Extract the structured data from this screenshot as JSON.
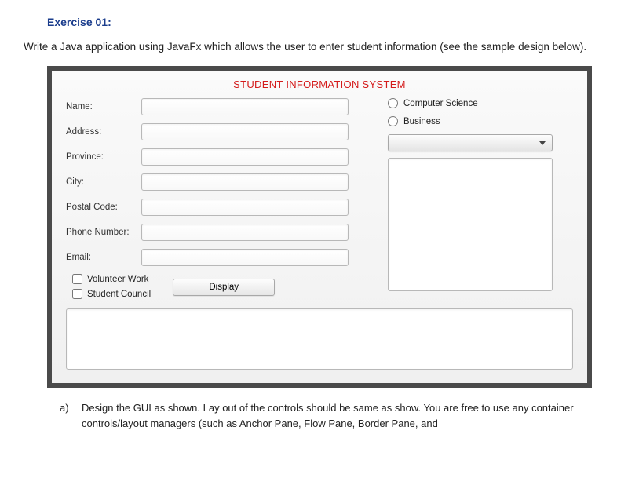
{
  "heading": "Exercise 01:",
  "intro": "Write a Java application using JavaFx which allows the user to enter student information (see the sample design below).",
  "app": {
    "title": "STUDENT INFORMATION SYSTEM",
    "fields": {
      "name": "Name:",
      "address": "Address:",
      "province": "Province:",
      "city": "City:",
      "postal": "Postal Code:",
      "phone": "Phone Number:",
      "email": "Email:"
    },
    "checkboxes": {
      "volunteer": "Volunteer Work",
      "council": "Student Council"
    },
    "displayButton": "Display",
    "radios": {
      "cs": "Computer Science",
      "business": "Business"
    }
  },
  "question": {
    "marker": "a)",
    "text": "Design the GUI as shown. Lay out of the controls should be same as show. You are free to use any container controls/layout managers (such as Anchor Pane, Flow Pane, Border Pane, and"
  }
}
